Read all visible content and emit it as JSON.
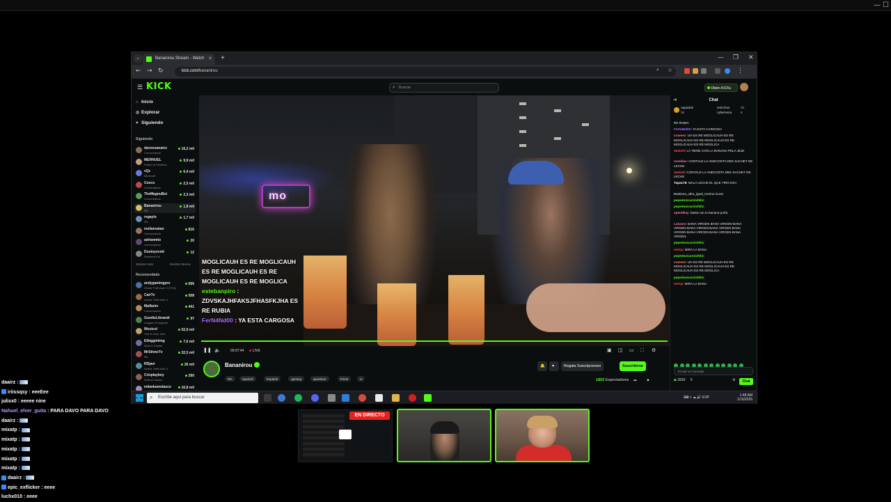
{
  "host_window": {
    "controls": [
      "—",
      "☐"
    ]
  },
  "browser": {
    "tab_title": "Bananirou Stream - Watch",
    "tab_close": "✕",
    "new_tab": "+",
    "url_host": "kick.com/",
    "url_path": "bananirou",
    "window_controls": [
      "—",
      "❐",
      "✕"
    ]
  },
  "kick": {
    "logo": "KICK",
    "search_placeholder": "Buscar",
    "get_kicks": "Obtén KICKs",
    "nav": [
      {
        "label": "Inicio",
        "icon": "⌂"
      },
      {
        "label": "Explorar",
        "icon": "◎"
      },
      {
        "label": "Siguiendo",
        "icon": "♥"
      }
    ],
    "following_heading": "Siguiendo",
    "following": [
      {
        "name": "davoosanaice",
        "cat": "Conversando",
        "viewers": "16,2 mil",
        "color": "#8b6f55"
      },
      {
        "name": "MERNUEL",
        "cat": "Pasen la Fabibieri...",
        "viewers": "9,9 mil",
        "color": "#c2a080"
      },
      {
        "name": "xQc",
        "cat": "Minecraft",
        "viewers": "6,4 mil",
        "color": "#6c7ad6"
      },
      {
        "name": "Coscu",
        "cat": "Conversando",
        "viewers": "2,5 mil",
        "color": "#b84a4a"
      },
      {
        "name": "TheMagnuBoi",
        "cat": "Conversando",
        "viewers": "2,3 mil",
        "color": "#5a9a60"
      },
      {
        "name": "Bananirou",
        "cat": "IRL",
        "viewers": "1,8 mil",
        "color": "#d8c060"
      },
      {
        "name": "regaylo",
        "cat": "IRL",
        "viewers": "1,7 mil",
        "color": "#7090b0"
      },
      {
        "name": "melianvaian",
        "cat": "Conversando",
        "viewers": "816",
        "color": "#a07060"
      },
      {
        "name": "adrianmto",
        "cat": "Conversando",
        "viewers": "20",
        "color": "#604870"
      },
      {
        "name": "Dostoyevski",
        "cat": "Resident Evil",
        "viewers": "12",
        "color": "#888888"
      }
    ],
    "show_more": "Mostrar más",
    "show_less": "Mostrar Menos",
    "recommended_heading": "Recomendado",
    "recommended": [
      {
        "name": "andygamingpro",
        "cat": "Grand Theft Auto V (GTA)",
        "viewers": "696",
        "color": "#4a6fa0"
      },
      {
        "name": "CairTv",
        "cat": "Grand Theft Auto V",
        "viewers": "508",
        "color": "#9a6a40"
      },
      {
        "name": "Maflantv",
        "cat": "Conversando",
        "viewers": "441",
        "color": "#bb8855"
      },
      {
        "name": "GuedisLibrandi",
        "cat": "League of Legends",
        "viewers": "97",
        "color": "#508050"
      },
      {
        "name": "Westcol",
        "cat": "Call of Duty: War...",
        "viewers": "52,9 mil",
        "color": "#c0a070"
      },
      {
        "name": "Elbiggieking",
        "cat": "Slots & Casino",
        "viewers": "7,6 mil",
        "color": "#7070a0"
      },
      {
        "name": "MrStiveeTv",
        "cat": "IRL",
        "viewers": "32,5 mil",
        "color": "#a05050"
      },
      {
        "name": "RDjavi",
        "cat": "Grand Theft Auto V",
        "viewers": "26 mil",
        "color": "#5a8aa0"
      },
      {
        "name": "Crisplayboy",
        "cat": "Slots & Casino",
        "viewers": "290",
        "color": "#906050"
      },
      {
        "name": "milankamolasco",
        "cat": "Conversando",
        "viewers": "16,8 mil",
        "color": "#a090b0"
      }
    ],
    "video_overlay_chat": {
      "msg1": "MOGLICAUH ES RE MOGLICAUH ES RE MOGLICAUH ES RE MOGLICAUH ES RE MOGLICA",
      "user2": "estebanpiro",
      "msg2": "ZDVSKAJHFAKSJFHASFKJHA ES RE RUBIA",
      "user3": "FerN4Nd00",
      "msg3": "YA ESTA CARGOSA"
    },
    "player": {
      "time": "00:07:44",
      "live": "LIVE"
    },
    "streamer": {
      "name": "Bananirou",
      "tags": [
        "IRL",
        "Spanish",
        "Español",
        "gaming",
        "speedrun",
        "Prime",
        "vr"
      ],
      "gift_subs": "Regala Suscripciones",
      "subscribe": "Suscribirse",
      "viewers": "1802",
      "viewers_label": "Espectadores"
    },
    "chat": {
      "title": "Chat",
      "pinned": [
        "Aguadob",
        "emirchus",
        "cybernena",
        "38",
        "30",
        "8"
      ],
      "messages": [
        {
          "u": "",
          "t": "RE RUBIA",
          "uc": "#ffffff"
        },
        {
          "u": "FerN4Nd00",
          "t": ": YA ESTA CARGOSA",
          "uc": "#a86bff"
        },
        {
          "u": "oraeeec",
          "t": ": UH ES RE MOGLICAUH ES RE MOGLICAUH ES RE MOGLICAUH ES RE MOGLICAUH ES RE MOGLICA",
          "uc": "#ff7a59"
        },
        {
          "u": "dadsiel",
          "t": ": LA TIENE CON LA BANANA PELA JEJE",
          "uc": "#ff4d4d"
        },
        {
          "u": "rasmilas",
          "t": ": CONTALE LA ANECODTA DEK SACHET DE LECHE",
          "uc": "#ff7aa8"
        },
        {
          "u": "dadsiel",
          "t": ": CONTALE LA ANECODTA DEK SACHET DE LECHE",
          "uc": "#ff4d4d"
        },
        {
          "u": "Tupac78",
          "t": ": MALA LECHE EL QUE TIRO ESA",
          "uc": "#ffffff"
        },
        {
          "u": "",
          "t": "Bastiana_ultra_igual_moirna mona",
          "uc": "#ffffff"
        },
        {
          "u": "pepeetuncarnixfeliz",
          "t": ":",
          "uc": "#53fc18"
        },
        {
          "u": "pepeetuncarnixfeliz",
          "t": ":",
          "uc": "#53fc18"
        },
        {
          "u": "opentikey",
          "t": ": basta con la banana porfa",
          "uc": "#ff7aa8"
        },
        {
          "u": "Lanzaro",
          "t": ": BANA VIRGEN BANA VIRGEN BANA VIRGEN BANA VIRGEN BANA VIRGEN BANA VIRGEN BANA VIRGEN BANA VIRGEN BANA VIRGEN",
          "uc": "#ff7aa8"
        },
        {
          "u": "pepeetuncarnixfeliz",
          "t": ":",
          "uc": "#53fc18"
        },
        {
          "u": "vivisp",
          "t": ": MIRA LA BANA",
          "uc": "#ff4d4d"
        },
        {
          "u": "pepeetuncarnixfeliz",
          "t": ":",
          "uc": "#53fc18"
        },
        {
          "u": "oraeeec",
          "t": ": UH ES RE MOGLICAUH ES RE MOGLICAUH ES RE MOGLICAUH ES RE MOGLICAUH ES RE MOGLICA",
          "uc": "#ff7a59"
        },
        {
          "u": "pepeetuncarnixfeliz",
          "t": ":",
          "uc": "#53fc18"
        },
        {
          "u": "vivisp",
          "t": ": MIRA LA BANA",
          "uc": "#ff4d4d"
        }
      ],
      "input_placeholder": "Enviar un mensaje",
      "points": "2830",
      "kicks": "0",
      "send": "Chat"
    }
  },
  "taskbar": {
    "search_placeholder": "Escribe aquí para buscar",
    "time": "1:48 AM",
    "date": "1/16/2026",
    "lang": "ESP"
  },
  "stream_chat": [
    {
      "user": "daairz",
      "text": ":",
      "purple": false,
      "badge": false,
      "emote": true
    },
    {
      "user": "iriissqsy",
      "text": ": eeeEee",
      "purple": false,
      "badge": true,
      "emote": false
    },
    {
      "user": "julixx0",
      "text": ": eeeee nine",
      "purple": false,
      "badge": false,
      "emote": false
    },
    {
      "user": "Nahuel_elver_guita",
      "text": ": PARA DAVO PARA DAVO",
      "purple": true,
      "badge": false,
      "emote": false
    },
    {
      "user": "daairz",
      "text": ":",
      "purple": false,
      "badge": false,
      "emote": true
    },
    {
      "user": "mixatp",
      "text": ":",
      "purple": false,
      "badge": false,
      "emote": true
    },
    {
      "user": "mixatp",
      "text": ":",
      "purple": false,
      "badge": false,
      "emote": true
    },
    {
      "user": "mixatp",
      "text": ":",
      "purple": false,
      "badge": false,
      "emote": true
    },
    {
      "user": "mixatp",
      "text": ":",
      "purple": false,
      "badge": false,
      "emote": true
    },
    {
      "user": "mixatp",
      "text": ":",
      "purple": false,
      "badge": false,
      "emote": true
    },
    {
      "user": "daairz",
      "text": ":",
      "purple": false,
      "badge": true,
      "emote": true
    },
    {
      "user": "epic_exflicker",
      "text": ": eeee",
      "purple": false,
      "badge": true,
      "emote": false
    },
    {
      "user": "luchx010",
      "text": ": eeee",
      "purple": false,
      "badge": false,
      "emote": false
    }
  ],
  "live_badge": "EN DIRECTO"
}
